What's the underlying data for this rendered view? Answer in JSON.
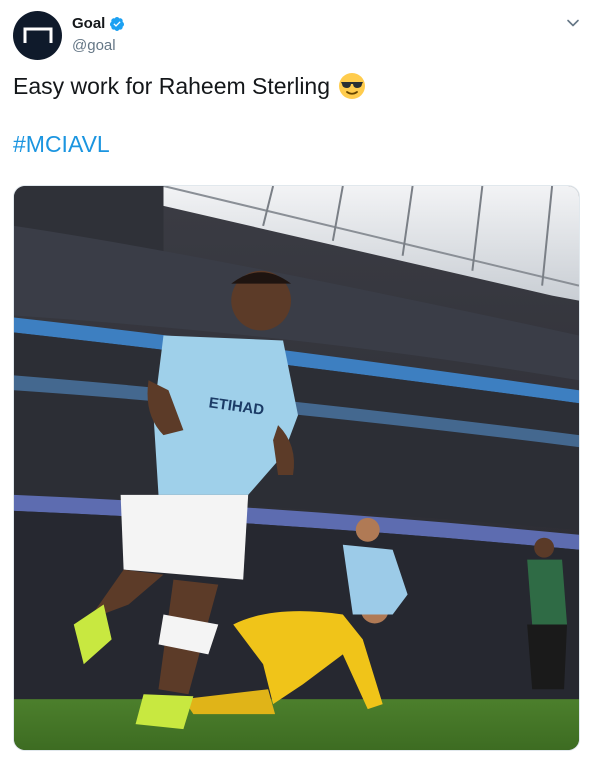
{
  "account": {
    "display_name": "Goal",
    "handle": "@goal",
    "verified": true,
    "avatar_icon": "goal-logo"
  },
  "tweet": {
    "text": "Easy work for Raheem Sterling",
    "emoji": "smiling-face-with-sunglasses",
    "hashtag": "#MCIAVL"
  },
  "colors": {
    "link": "#1b95e0",
    "verified": "#1da1f2"
  },
  "media": {
    "kind": "photo",
    "jersey_sponsor": "ETIHAD",
    "icon": "photo"
  }
}
